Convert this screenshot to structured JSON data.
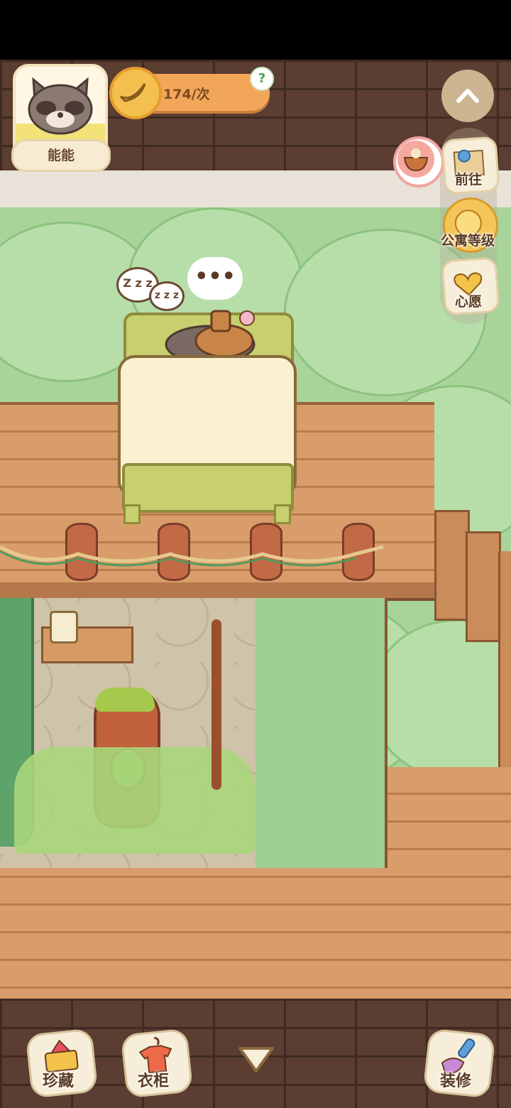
{
  "player": {
    "name": "能能"
  },
  "energy": {
    "value_text": "174/次",
    "help": "?"
  },
  "side_menu": {
    "go_label": "前往",
    "apartment_level_label": "公寓等级",
    "wish_label": "心愿"
  },
  "room": {
    "zzz_big": "Z z z",
    "zzz_small": "z z z",
    "speech": "•••"
  },
  "bottom_bar": {
    "collection_label": "珍藏",
    "wardrobe_label": "衣柜",
    "decorate_label": "装修"
  },
  "icons": {
    "avatar": "raccoon-avatar-icon",
    "energy": "banana-icon",
    "collapse": "chevron-up-icon",
    "bowl": "food-bowl-icon",
    "go": "map-icon",
    "level": "cat-badge-icon",
    "wish": "heart-book-icon",
    "collection": "treasure-icon",
    "wardrobe": "shirt-hanger-icon",
    "expand": "triangle-down-icon",
    "decorate": "paintbrush-icon"
  },
  "colors": {
    "energy_bar": "#f2a65a",
    "wall": "#5b3d31",
    "floor": "#d89d6a",
    "foliage": "#a8d49a"
  }
}
